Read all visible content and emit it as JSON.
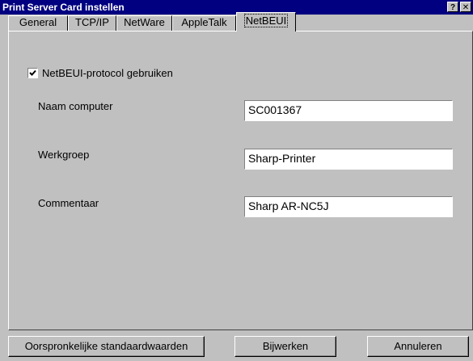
{
  "window": {
    "title": "Print Server Card instellen",
    "help_label": "?",
    "close_label": "✕"
  },
  "tabs": [
    {
      "label": "General"
    },
    {
      "label": "TCP/IP"
    },
    {
      "label": "NetWare"
    },
    {
      "label": "AppleTalk"
    },
    {
      "label": "NetBEUI",
      "active": true
    }
  ],
  "netbeui": {
    "use_protocol_label": "NetBEUI-protocol gebruiken",
    "use_protocol_checked": true,
    "computer_name_label": "Naam computer",
    "computer_name_value": "SC001367",
    "workgroup_label": "Werkgroep",
    "workgroup_value": "Sharp-Printer",
    "comment_label": "Commentaar",
    "comment_value": "Sharp AR-NC5J"
  },
  "buttons": {
    "defaults_label": "Oorspronkelijke standaardwaarden",
    "update_label": "Bijwerken",
    "cancel_label": "Annuleren"
  }
}
